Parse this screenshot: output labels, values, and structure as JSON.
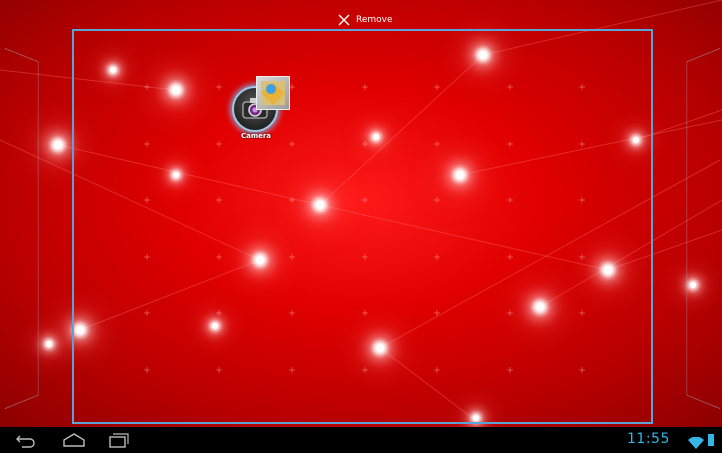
{
  "remove_target": {
    "label": "Remove",
    "icon": "close-icon"
  },
  "dragged_app": {
    "label": "Camera",
    "icon": "camera-icon",
    "overlay_icon": "gallery-icon"
  },
  "status_bar": {
    "time": "11:55",
    "wifi_icon": "wifi-icon",
    "battery_icon": "battery-icon"
  },
  "nav_bar": {
    "back_icon": "back-icon",
    "home_icon": "home-icon",
    "recents_icon": "recents-icon"
  },
  "colors": {
    "wallpaper": "#d40000",
    "frame": "#5aa3d6",
    "accent": "#33b5e5"
  }
}
